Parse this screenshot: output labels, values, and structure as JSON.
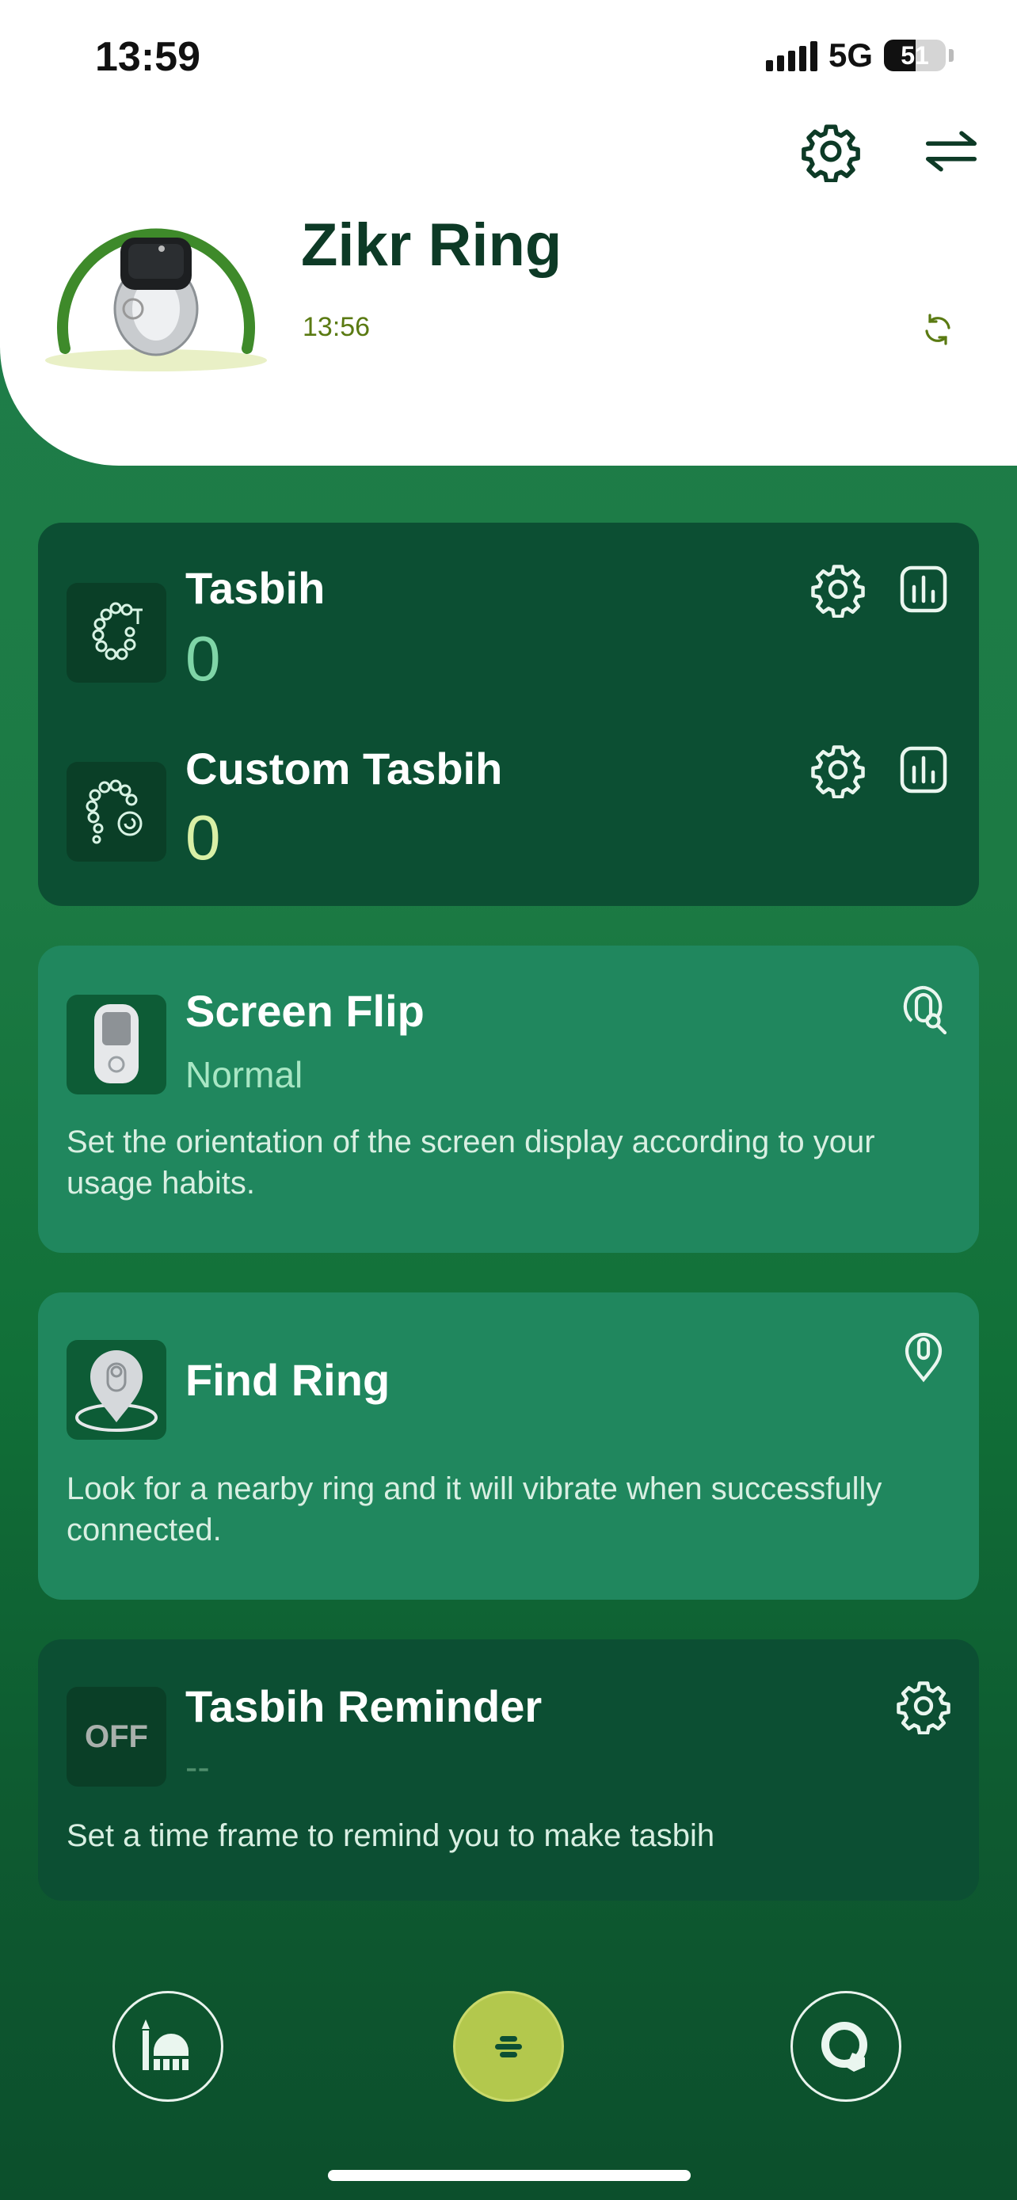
{
  "status_bar": {
    "time": "13:59",
    "network": "5G",
    "battery": "51",
    "battery_level": 0.51
  },
  "header": {
    "device_name": "Zikr Ring",
    "last_sync_time": "13:56",
    "icons": [
      "settings-icon",
      "switch-device-icon",
      "refresh-icon"
    ]
  },
  "counters": [
    {
      "title": "Tasbih",
      "count": "0",
      "icon": "prayer-beads-icon",
      "count_color": "#7fd5a7"
    },
    {
      "title": "Custom Tasbih",
      "count": "0",
      "icon": "custom-beads-icon",
      "count_color": "#d9f0a6"
    }
  ],
  "screen_flip": {
    "title": "Screen Flip",
    "value": "Normal",
    "description": "Set the orientation of the screen display according to your usage habits."
  },
  "find_ring": {
    "title": "Find Ring",
    "description": "Look for a nearby ring and it will vibrate when successfully connected."
  },
  "reminder": {
    "badge": "OFF",
    "title": "Tasbih Reminder",
    "value": "--",
    "description": "Set a time frame to remind you to make tasbih"
  },
  "bottom_nav": {
    "items": [
      {
        "name": "mosque",
        "icon": "mosque-icon"
      },
      {
        "name": "zikr",
        "icon": "tasbih-icon",
        "active": true
      },
      {
        "name": "ring",
        "icon": "ring-icon"
      }
    ]
  },
  "colors": {
    "brand_dark": "#0c4f33",
    "brand_light": "#20875e",
    "accent_lime": "#b3c84d",
    "ring_arc": "#3e8a2a"
  }
}
